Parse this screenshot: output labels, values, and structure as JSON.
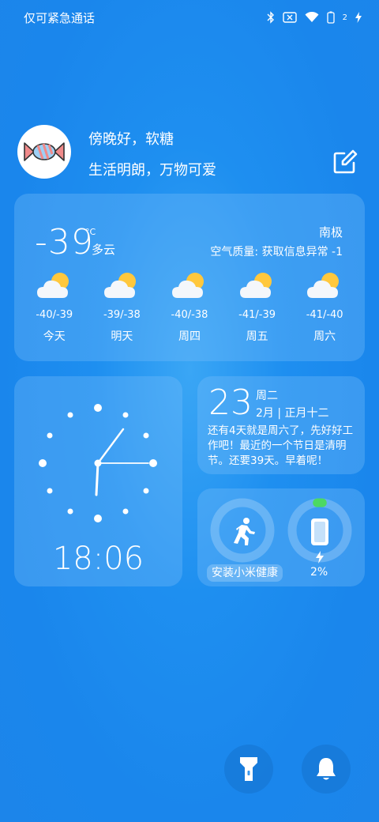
{
  "status_bar": {
    "left_text": "仅可紧急通话",
    "sim_badge": "2"
  },
  "profile": {
    "greeting": "傍晚好，软糖",
    "motto": "生活明朗，万物可爱"
  },
  "weather": {
    "temperature": "-39",
    "unit": "°C",
    "condition": "多云",
    "location": "南极",
    "air_quality": "空气质量: 获取信息异常 -1",
    "forecast": [
      {
        "range": "-40/-39",
        "day": "今天"
      },
      {
        "range": "-39/-38",
        "day": "明天"
      },
      {
        "range": "-40/-38",
        "day": "周四"
      },
      {
        "range": "-41/-39",
        "day": "周五"
      },
      {
        "range": "-41/-40",
        "day": "周六"
      }
    ]
  },
  "clock": {
    "time": "18:06"
  },
  "date": {
    "day_number": "23",
    "weekday": "周二",
    "lunar": "2月 | 正月十二",
    "message": "还有4天就是周六了，先好好工作吧！最近的一个节日是清明节。还要39天。早着呢！"
  },
  "health": {
    "install_label": "安装小米健康",
    "battery_percent": "2%",
    "battery_level": 0.02
  },
  "colors": {
    "background": "#1e8ff0",
    "battery_green": "#4cd964",
    "sun": "#ffc83d"
  }
}
